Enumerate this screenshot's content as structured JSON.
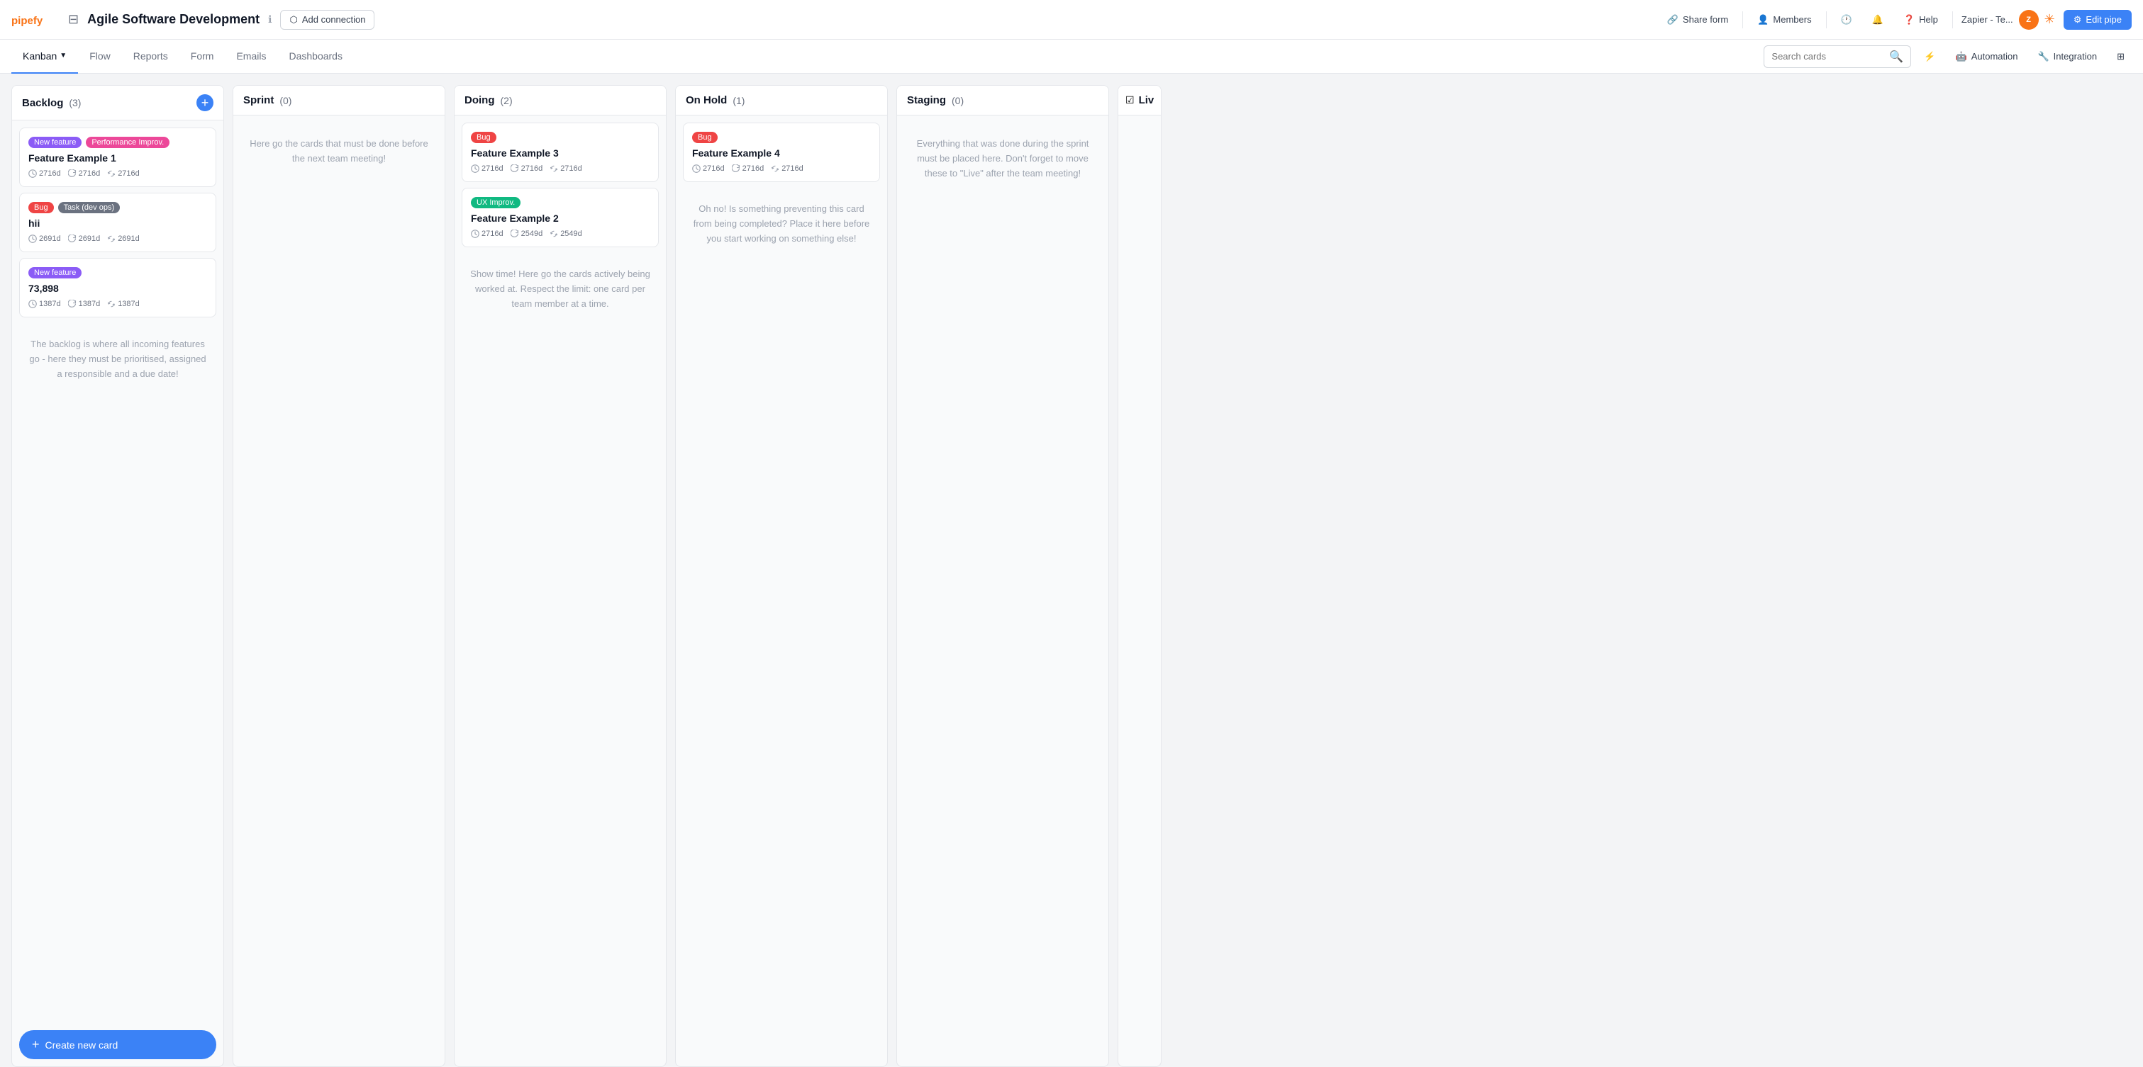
{
  "app": {
    "logo_text": "pipefy",
    "board_title": "Agile Software Development"
  },
  "topnav": {
    "add_connection": "Add connection",
    "share_form": "Share form",
    "members": "Members",
    "help": "Help",
    "user_label": "Zapier - Te...",
    "edit_pipe": "Edit pipe"
  },
  "subnav": {
    "items": [
      {
        "label": "Kanban",
        "active": true
      },
      {
        "label": "Flow",
        "active": false
      },
      {
        "label": "Reports",
        "active": false
      },
      {
        "label": "Form",
        "active": false
      },
      {
        "label": "Emails",
        "active": false
      },
      {
        "label": "Dashboards",
        "active": false
      }
    ],
    "search_placeholder": "Search cards",
    "automation": "Automation",
    "integration": "Integration"
  },
  "columns": [
    {
      "id": "backlog",
      "title": "Backlog",
      "count": 3,
      "color": "#3b82f6",
      "show_add": true,
      "hint": "The backlog is where all incoming features go - here they must be prioritised, assigned a responsible and a due date!",
      "cards": [
        {
          "tags": [
            {
              "label": "New feature",
              "class": "tag-new-feature"
            },
            {
              "label": "Performance Improv.",
              "class": "tag-performance"
            }
          ],
          "title": "Feature Example 1",
          "meta": [
            {
              "icon": "clock",
              "value": "2716d"
            },
            {
              "icon": "refresh",
              "value": "2716d"
            },
            {
              "icon": "sync",
              "value": "2716d"
            }
          ]
        },
        {
          "tags": [
            {
              "label": "Bug",
              "class": "tag-bug"
            },
            {
              "label": "Task (dev ops)",
              "class": "tag-task"
            }
          ],
          "title": "hii",
          "meta": [
            {
              "icon": "clock",
              "value": "2691d"
            },
            {
              "icon": "refresh",
              "value": "2691d"
            },
            {
              "icon": "sync",
              "value": "2691d"
            }
          ]
        },
        {
          "tags": [
            {
              "label": "New feature",
              "class": "tag-new-feature"
            }
          ],
          "title": "73,898",
          "meta": [
            {
              "icon": "clock",
              "value": "1387d"
            },
            {
              "icon": "refresh",
              "value": "1387d"
            },
            {
              "icon": "sync",
              "value": "1387d"
            }
          ]
        }
      ],
      "footer_btn": "Create new card"
    },
    {
      "id": "sprint",
      "title": "Sprint",
      "count": 0,
      "color": "#6b7280",
      "show_add": false,
      "hint": "Here go the cards that must be done before the next team meeting!",
      "cards": []
    },
    {
      "id": "doing",
      "title": "Doing",
      "count": 2,
      "color": "#6b7280",
      "show_add": false,
      "hint": "Show time! Here go the cards actively being worked at. Respect the limit: one card per team member at a time.",
      "cards": [
        {
          "tags": [
            {
              "label": "Bug",
              "class": "tag-bug"
            }
          ],
          "title": "Feature Example 3",
          "meta": [
            {
              "icon": "clock",
              "value": "2716d"
            },
            {
              "icon": "refresh",
              "value": "2716d"
            },
            {
              "icon": "sync",
              "value": "2716d"
            }
          ]
        },
        {
          "tags": [
            {
              "label": "UX Improv.",
              "class": "tag-ux"
            }
          ],
          "title": "Feature Example 2",
          "meta": [
            {
              "icon": "clock",
              "value": "2716d"
            },
            {
              "icon": "refresh",
              "value": "2549d"
            },
            {
              "icon": "sync",
              "value": "2549d"
            }
          ]
        }
      ]
    },
    {
      "id": "on-hold",
      "title": "On Hold",
      "count": 1,
      "color": "#6b7280",
      "show_add": false,
      "hint": "Oh no! Is something preventing this card from being completed? Place it here before you start working on something else!",
      "cards": [
        {
          "tags": [
            {
              "label": "Bug",
              "class": "tag-bug"
            }
          ],
          "title": "Feature Example 4",
          "meta": [
            {
              "icon": "clock",
              "value": "2716d"
            },
            {
              "icon": "refresh",
              "value": "2716d"
            },
            {
              "icon": "sync",
              "value": "2716d"
            }
          ]
        }
      ]
    },
    {
      "id": "staging",
      "title": "Staging",
      "count": 0,
      "color": "#3b82f6",
      "show_add": false,
      "hint": "Everything that was done during the sprint must be placed here. Don't forget to move these to \"Live\" after the team meeting!",
      "cards": []
    }
  ],
  "partial_column": {
    "title": "Liv",
    "icon": "checkbox"
  },
  "icons": {
    "clock": "🕐",
    "refresh": "🔄",
    "sync": "🔃",
    "search": "🔍",
    "filter": "⚡",
    "gear": "⚙",
    "grid": "⊞",
    "bell": "🔔",
    "link": "🔗",
    "user": "👤",
    "plus": "+",
    "chevron": "▼"
  }
}
